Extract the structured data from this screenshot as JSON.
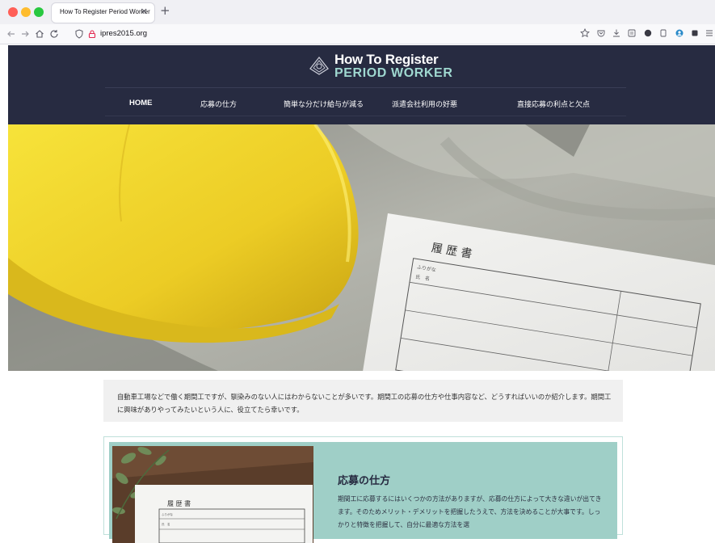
{
  "browser": {
    "tab_title": "How To Register Period Worker",
    "tab_close": "×",
    "new_tab": "+",
    "url": "ipres2015.org"
  },
  "site": {
    "logo_line1": "How To Register",
    "logo_line2": "PERIOD WORKER",
    "menu": [
      {
        "label": "HOME"
      },
      {
        "label": "応募の仕方"
      },
      {
        "label": "簡単な分だけ給与が減る"
      },
      {
        "label": "派遣会社利用の好悪"
      },
      {
        "label": "直接応募の利点と欠点"
      }
    ]
  },
  "intro": {
    "text": "自動車工場などで働く期間工ですが、馴染みのない人にはわからないことが多いです。期間工の応募の仕方や仕事内容など、どうすればいいのか紹介します。期間工に興味がありやってみたいという人に、役立てたら幸いです。"
  },
  "card": {
    "title": "応募の仕方",
    "text": "期間工に応募するにはいくつかの方法がありますが、応募の仕方によって大きな違いが出てきます。そのためメリット・デメリットを把握したうえで、方法を決めることが大事です。しっかりと特徴を把握して、自分に最適な方法を選"
  },
  "hero_image": {
    "form_title": "履 歴 書",
    "form_furigana": "ふりがな",
    "form_name": "氏　名"
  },
  "card_image": {
    "form_title": "履 歴 書",
    "form_furigana": "ふりがな",
    "form_name": "氏　名"
  },
  "colors": {
    "header_bg": "#272b41",
    "accent_teal": "#9fd8d0",
    "card_bg": "#9fcfc7",
    "intro_bg": "#f0f0f0",
    "helmet": "#f1d22b"
  },
  "icons": [
    "back-arrow-icon",
    "forward-arrow-icon",
    "home-icon",
    "reload-icon",
    "shield-icon",
    "lock-icon",
    "star-icon",
    "pocket-icon",
    "download-icon",
    "reader-icon",
    "extension-icon",
    "sidebar-icon",
    "account-icon",
    "menu-icon"
  ]
}
